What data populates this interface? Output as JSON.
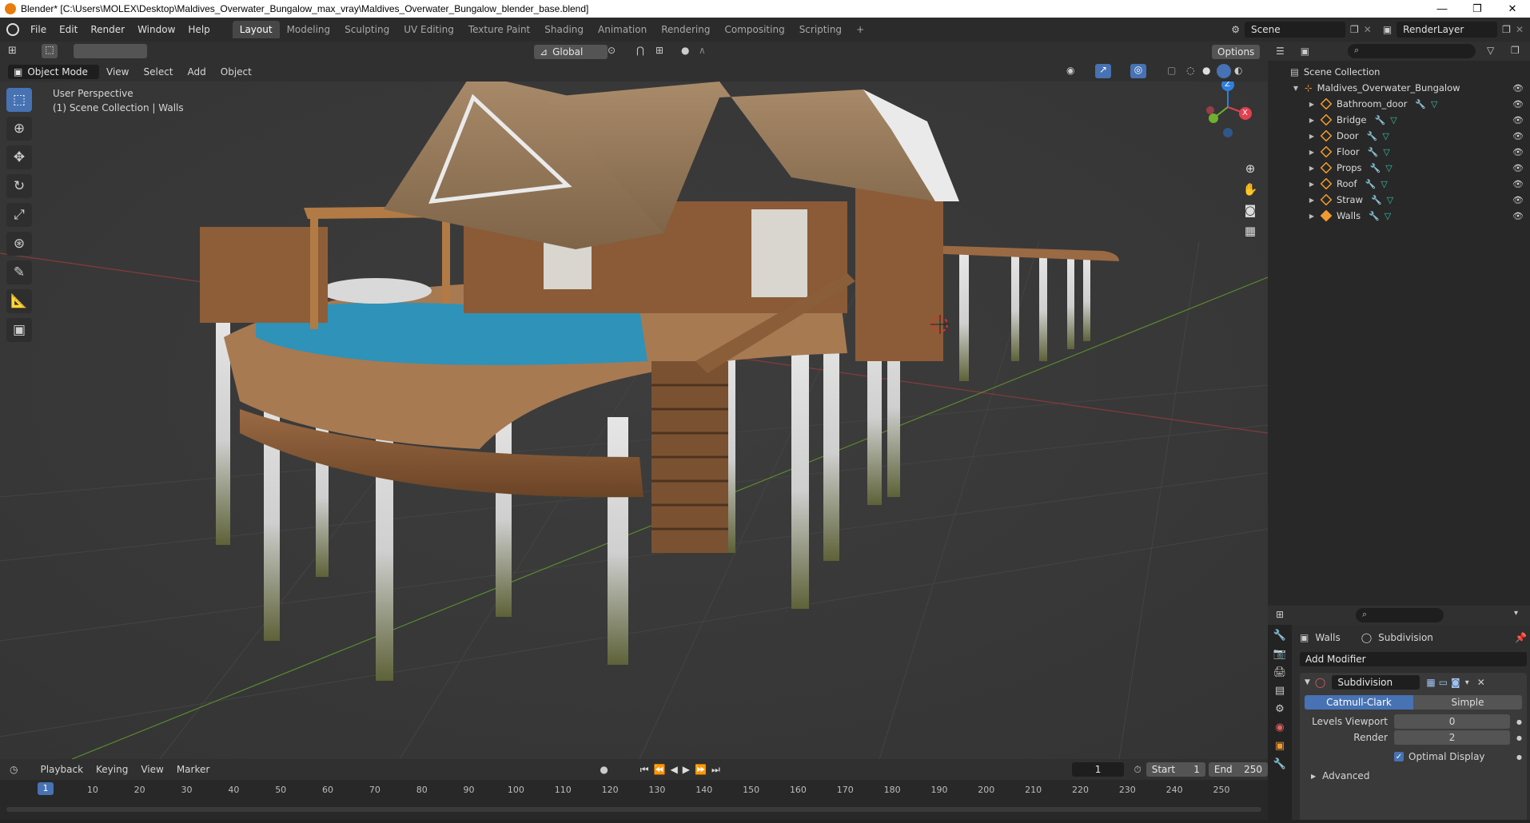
{
  "titlebar": {
    "title": "Blender* [C:\\Users\\MOLEX\\Desktop\\Maldives_Overwater_Bungalow_max_vray\\Maldives_Overwater_Bungalow_blender_base.blend]",
    "min": "—",
    "restore": "❐",
    "close": "✕"
  },
  "menu": [
    "File",
    "Edit",
    "Render",
    "Window",
    "Help"
  ],
  "workspaces": [
    "Layout",
    "Modeling",
    "Sculpting",
    "UV Editing",
    "Texture Paint",
    "Shading",
    "Animation",
    "Rendering",
    "Compositing",
    "Scripting"
  ],
  "workspace_add": "+",
  "scene": "Scene",
  "render_layer": "RenderLayer",
  "toolbar": {
    "orientation": "Global",
    "options": "Options"
  },
  "header3d": {
    "mode": "Object Mode",
    "menus": [
      "View",
      "Select",
      "Add",
      "Object"
    ]
  },
  "viewport": {
    "perspective": "User Perspective",
    "collection": "(1) Scene Collection | Walls"
  },
  "gizmo": {
    "z": "Z",
    "x": "X"
  },
  "outliner": {
    "root": "Scene Collection",
    "collection": "Maldives_Overwater_Bungalow",
    "objects": [
      "Bathroom_door",
      "Bridge",
      "Door",
      "Floor",
      "Props",
      "Roof",
      "Straw",
      "Walls"
    ]
  },
  "properties": {
    "object": "Walls",
    "modifier_name_header": "Subdivision",
    "add_modifier": "Add Modifier",
    "modifier_name": "Subdivision",
    "mode_a": "Catmull-Clark",
    "mode_b": "Simple",
    "levels_viewport_label": "Levels Viewport",
    "levels_viewport": "0",
    "render_label": "Render",
    "render": "2",
    "optimal_display": "Optimal Display",
    "advanced": "Advanced"
  },
  "timeline": {
    "menus": [
      "Playback",
      "Keying",
      "View",
      "Marker"
    ],
    "current_frame": "1",
    "start_label": "Start",
    "start": "1",
    "end_label": "End",
    "end": "250",
    "ticks": [
      "1",
      "10",
      "20",
      "30",
      "40",
      "50",
      "60",
      "70",
      "80",
      "90",
      "100",
      "110",
      "120",
      "130",
      "140",
      "150",
      "160",
      "170",
      "180",
      "190",
      "200",
      "210",
      "220",
      "230",
      "240",
      "250"
    ]
  },
  "colors": {
    "accent": "#4772b3",
    "outliner_mesh": "#f19a31",
    "pool": "#2f92b8"
  }
}
